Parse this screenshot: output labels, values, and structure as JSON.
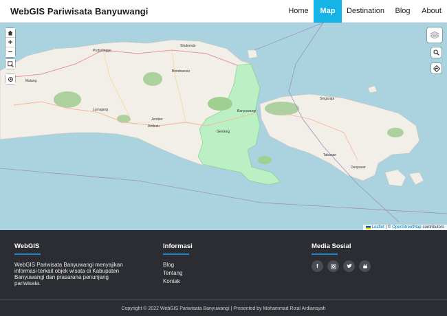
{
  "navbar": {
    "brand": "WebGIS Pariwisata Banyuwangi",
    "items": [
      {
        "label": "Home",
        "active": false
      },
      {
        "label": "Map",
        "active": true
      },
      {
        "label": "Destination",
        "active": false
      },
      {
        "label": "Blog",
        "active": false
      },
      {
        "label": "About",
        "active": false
      }
    ]
  },
  "map": {
    "zoom_in": "+",
    "zoom_out": "−",
    "place_labels": [
      "Probolinggo",
      "Situbondo",
      "Bondowoso",
      "Malang",
      "Lumajang",
      "Jember",
      "Banyuwangi",
      "Genteng",
      "Denpasar",
      "Singaraja",
      "Ambulu",
      "Tabanan"
    ],
    "attribution": {
      "leaflet": "Leaflet",
      "separator": "| ©",
      "osm": "OpenStreetMap",
      "suffix": "contributors"
    },
    "colors": {
      "water": "#aad3df",
      "land": "#f2efe9",
      "highlight": "#b9efc3",
      "forest": "#add19e",
      "boundary": "#9e8fb8"
    }
  },
  "footer": {
    "webgis": {
      "title": "WebGIS",
      "text": "WebGIS Pariwisata Banyuwangi menyajikan informasi terkait objek wisata di Kabupaten Banyuwangi dan prasarana penunjang pariwisata."
    },
    "informasi": {
      "title": "Informasi",
      "links": [
        "Blog",
        "Tentang",
        "Kontak"
      ]
    },
    "media": {
      "title": "Media Sosial",
      "icons": [
        "facebook-icon",
        "instagram-icon",
        "twitter-icon",
        "youtube-icon"
      ]
    },
    "copyright": "Copyright © 2022 WebGIS Pariwisata Banyuwangi | Presented by Mohammad Rizal Ardiansyah"
  }
}
